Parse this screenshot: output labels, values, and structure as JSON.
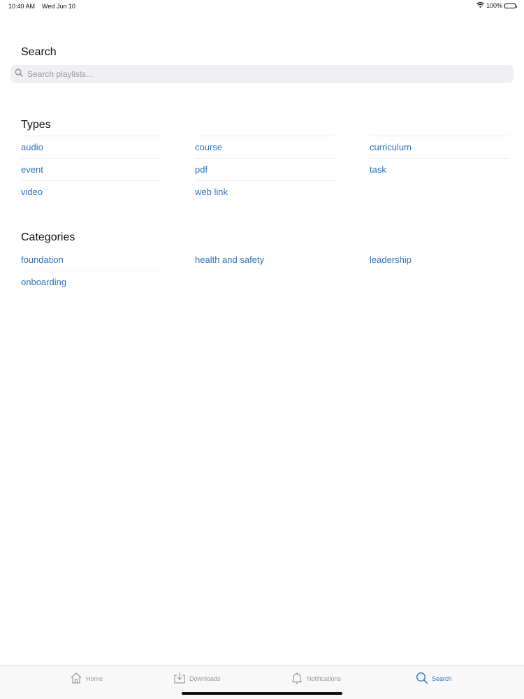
{
  "status_bar": {
    "time": "10:40 AM",
    "date": "Wed Jun 10",
    "battery": "100%"
  },
  "search": {
    "title": "Search",
    "placeholder": "Search playlists...",
    "value": ""
  },
  "types": {
    "title": "Types",
    "items": [
      "audio",
      "course",
      "curriculum",
      "event",
      "pdf",
      "task",
      "video",
      "web link"
    ]
  },
  "categories": {
    "title": "Categories",
    "items": [
      "foundation",
      "health and safety",
      "leadership",
      "onboarding"
    ]
  },
  "tab_bar": {
    "tabs": [
      {
        "label": "Home",
        "icon": "home-icon",
        "active": false
      },
      {
        "label": "Downloads",
        "icon": "downloads-icon",
        "active": false
      },
      {
        "label": "Notifications",
        "icon": "bell-icon",
        "active": false
      },
      {
        "label": "Search",
        "icon": "search-icon",
        "active": true
      }
    ]
  },
  "colors": {
    "accent": "#2f73b7",
    "inactive": "#9a9aa0",
    "search_bg": "#f0f0f2"
  }
}
